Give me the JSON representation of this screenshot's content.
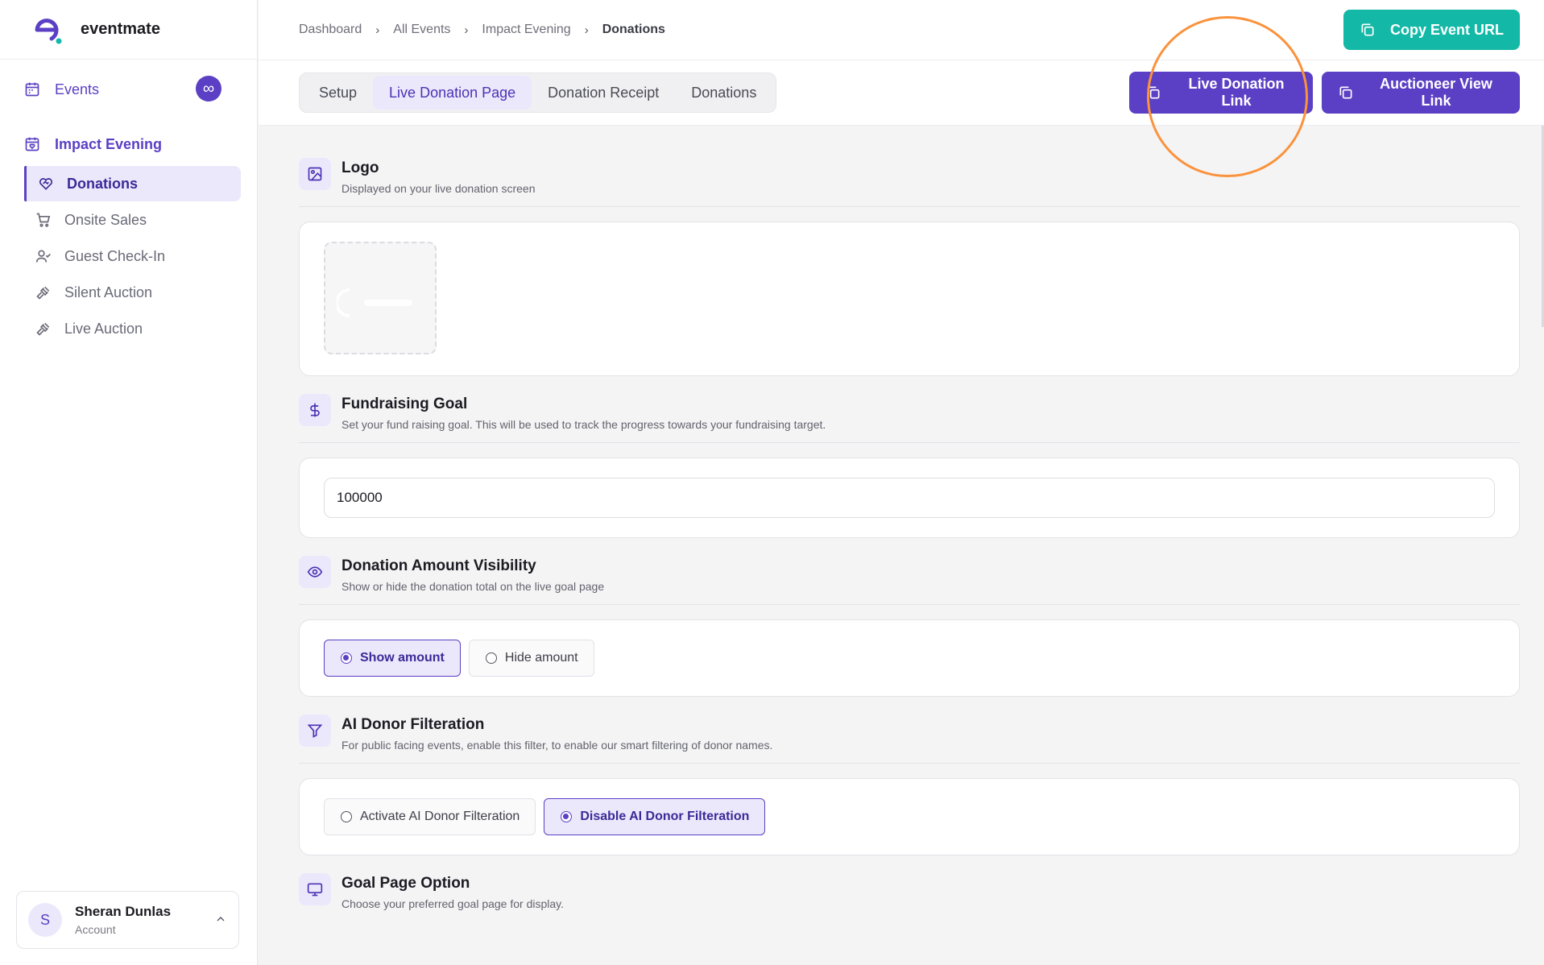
{
  "brand": {
    "name": "eventmate",
    "accent": "#5b3fc4",
    "dot": "#14b8a6"
  },
  "sidebar": {
    "events_label": "Events",
    "group_title": "Impact Evening",
    "items": [
      {
        "label": "Donations",
        "icon": "heart-handshake-icon",
        "active": true
      },
      {
        "label": "Onsite Sales",
        "icon": "cart-icon"
      },
      {
        "label": "Guest Check-In",
        "icon": "user-check-icon"
      },
      {
        "label": "Silent Auction",
        "icon": "gavel-icon"
      },
      {
        "label": "Live Auction",
        "icon": "gavel-icon"
      }
    ],
    "account": {
      "initial": "S",
      "name": "Sheran Dunlas",
      "role": "Account"
    }
  },
  "breadcrumb": [
    "Dashboard",
    "All Events",
    "Impact Evening",
    "Donations"
  ],
  "header": {
    "copy_url_label": "Copy Event URL"
  },
  "tabs": [
    {
      "label": "Setup"
    },
    {
      "label": "Live Donation Page",
      "active": true
    },
    {
      "label": "Donation Receipt"
    },
    {
      "label": "Donations"
    }
  ],
  "actions": {
    "live_link_label": "Live Donation Link",
    "auctioneer_label": "Auctioneer View Link"
  },
  "sections": {
    "logo": {
      "title": "Logo",
      "desc": "Displayed on your live donation screen"
    },
    "goal": {
      "title": "Fundraising Goal",
      "desc": "Set your fund raising goal. This will be used to track the progress towards your fundraising target.",
      "value": "100000"
    },
    "visibility": {
      "title": "Donation Amount Visibility",
      "desc": "Show or hide the donation total on the live goal page",
      "options": [
        "Show amount",
        "Hide amount"
      ],
      "selected": "Show amount"
    },
    "ai_filter": {
      "title": "AI Donor Filteration",
      "desc": "For public facing events, enable this filter, to enable our smart filtering of donor names.",
      "options": [
        "Activate AI Donor Filteration",
        "Disable AI Donor Filteration"
      ],
      "selected": "Disable AI Donor Filteration"
    },
    "goal_page": {
      "title": "Goal Page Option",
      "desc": "Choose your preferred goal page for display."
    }
  }
}
